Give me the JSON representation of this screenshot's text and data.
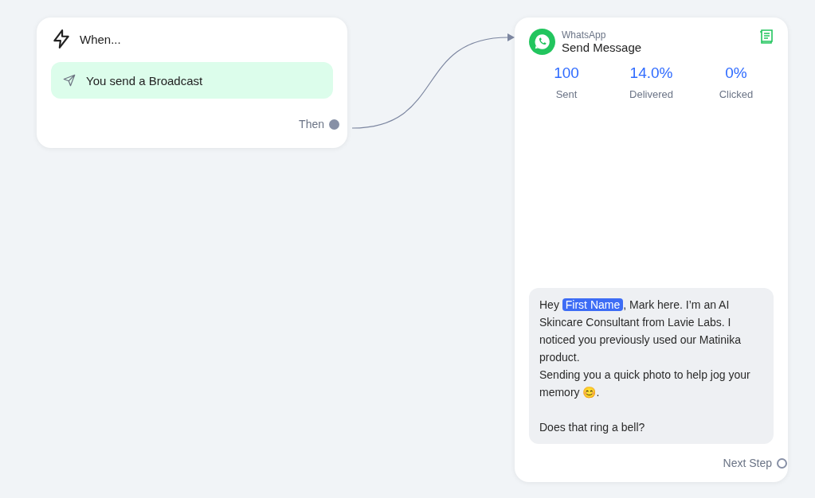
{
  "trigger_node": {
    "title": "When...",
    "trigger": {
      "label": "You send a Broadcast"
    },
    "output_handle": {
      "label": "Then"
    }
  },
  "action_node": {
    "channel": "WhatsApp",
    "title": "Send Message",
    "stats": [
      {
        "value": "100",
        "label": "Sent"
      },
      {
        "value": "14.0%",
        "label": "Delivered"
      },
      {
        "value": "0%",
        "label": "Clicked"
      }
    ],
    "message": {
      "greeting": "Hey ",
      "variable": "First Name",
      "body": ", Mark here. I’m an AI Skincare Consultant from Lavie Labs. I noticed you previously used our Matinika product.\nSending you a quick photo to help jog your memory 😊.\n\nDoes that ring a bell?"
    },
    "output_handle": {
      "label": "Next Step"
    }
  }
}
